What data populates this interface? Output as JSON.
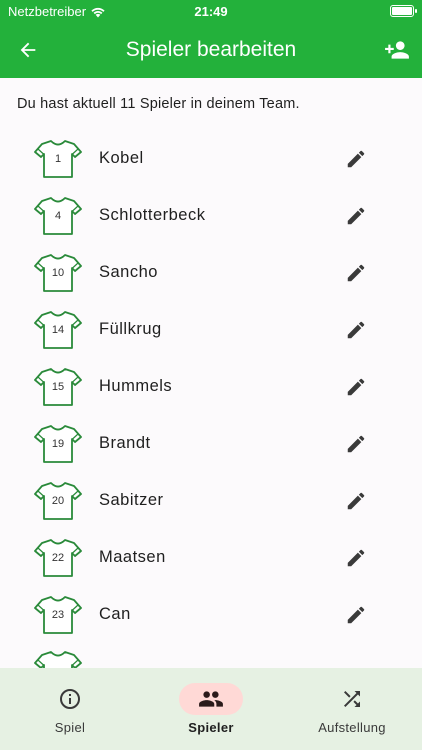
{
  "status_bar": {
    "carrier": "Netzbetreiber",
    "time": "21:49"
  },
  "app_bar": {
    "title": "Spieler bearbeiten",
    "back_icon": "arrow-left-icon",
    "add_icon": "person-add-icon"
  },
  "info": {
    "text": "Du hast aktuell 11 Spieler in deinem Team."
  },
  "players": [
    {
      "number": "1",
      "name": "Kobel"
    },
    {
      "number": "4",
      "name": "Schlotterbeck"
    },
    {
      "number": "10",
      "name": "Sancho"
    },
    {
      "number": "14",
      "name": "Füllkrug"
    },
    {
      "number": "15",
      "name": "Hummels"
    },
    {
      "number": "19",
      "name": "Brandt"
    },
    {
      "number": "20",
      "name": "Sabitzer"
    },
    {
      "number": "22",
      "name": "Maatsen"
    },
    {
      "number": "23",
      "name": "Can"
    }
  ],
  "bottom_nav": [
    {
      "label": "Spiel",
      "icon": "info-icon",
      "active": false
    },
    {
      "label": "Spieler",
      "icon": "group-icon",
      "active": true
    },
    {
      "label": "Aufstellung",
      "icon": "shuffle-icon",
      "active": false
    }
  ],
  "colors": {
    "primary": "#23b13b",
    "jersey": "#2a8a3a",
    "nav_bg": "#e6f1e3",
    "active_pill": "#ffd9d6"
  }
}
